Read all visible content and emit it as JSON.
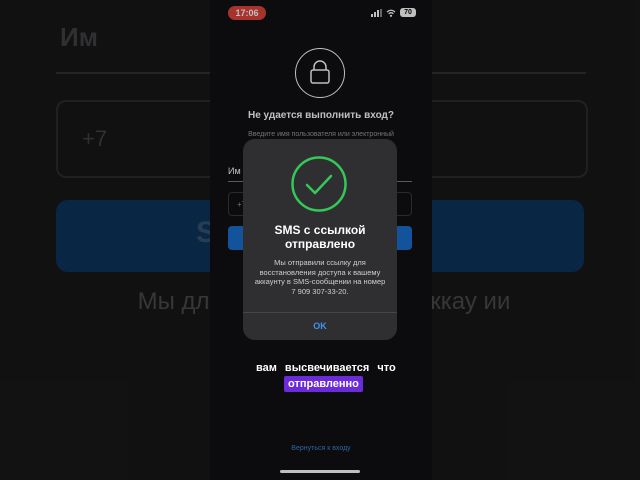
{
  "background": {
    "tab_text": "Им",
    "field_text": "+7",
    "button_text": "S                      й",
    "text": "Мы             для восстан            вашему аккау            ии на но                  20."
  },
  "status_bar": {
    "time": "17:06",
    "battery": "70"
  },
  "screen": {
    "title": "Не удается выполнить вход?",
    "subtitle": "Введите имя пользователя или электронный",
    "tab_label": "Им",
    "phone_field_value": "+7",
    "back_link": "Вернуться к входу"
  },
  "alert": {
    "title": "SMS с ссылкой отправлено",
    "message": "Мы отправили ссылку для восстановления доступа к вашему аккаунту в SMS-сообщении на номер 7 909 307-33-20.",
    "ok_label": "OK"
  },
  "captions": {
    "line1": "вам высвечивается что",
    "line2": "отправленно"
  },
  "colors": {
    "accent": "#3d93f0",
    "success": "#34c759",
    "caption_bg": "#6c2bd9",
    "time_badge": "#e0443d"
  },
  "icons": [
    "lock-icon",
    "checkmark-icon",
    "signal-icon",
    "wifi-icon",
    "battery-icon"
  ]
}
